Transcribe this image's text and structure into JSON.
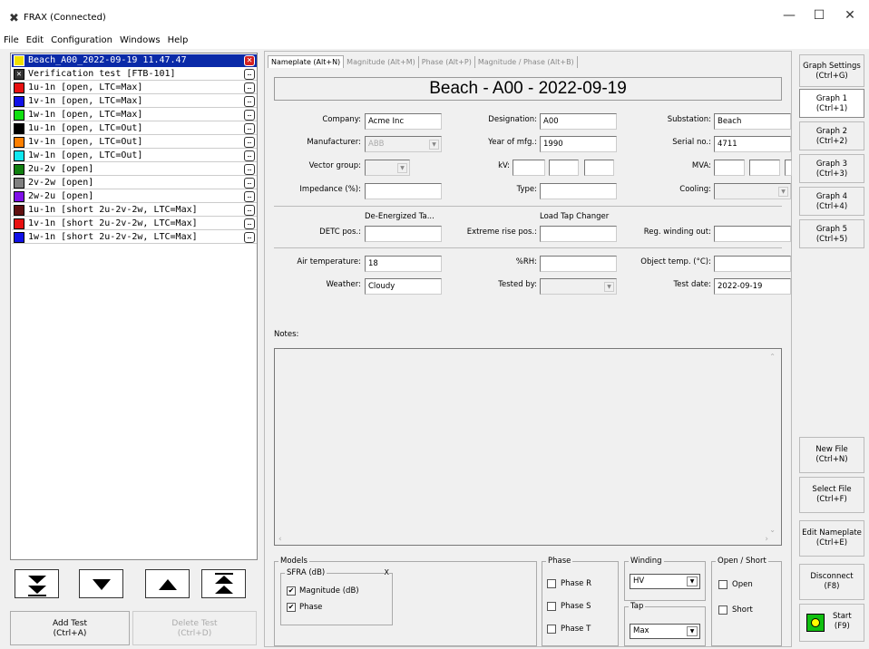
{
  "window": {
    "title": "FRAX (Connected)",
    "minimize": "—",
    "maximize": "☐",
    "close": "✕"
  },
  "menu": [
    "File",
    "Edit",
    "Configuration",
    "Windows",
    "Help"
  ],
  "tests": [
    {
      "label": "Beach_A00_2022-09-19 11.47.47",
      "color": "#0a2aa8",
      "selected": true
    },
    {
      "label": "Verification test [FTB-101]",
      "color": "#ffffff",
      "icon": "x"
    },
    {
      "label": "1u-1n [open, LTC=Max]",
      "color": "#e81010"
    },
    {
      "label": "1v-1n [open, LTC=Max]",
      "color": "#1010e8"
    },
    {
      "label": "1w-1n [open, LTC=Max]",
      "color": "#10e010"
    },
    {
      "label": "1u-1n [open, LTC=Out]",
      "color": "#000000"
    },
    {
      "label": "1v-1n [open, LTC=Out]",
      "color": "#ff8000"
    },
    {
      "label": "1w-1n [open, LTC=Out]",
      "color": "#10e8f0"
    },
    {
      "label": "2u-2v [open]",
      "color": "#108010"
    },
    {
      "label": "2v-2w [open]",
      "color": "#808080"
    },
    {
      "label": "2w-2u [open]",
      "color": "#8010e8"
    },
    {
      "label": "1u-1n [short 2u-2v-2w, LTC=Max]",
      "color": "#601010"
    },
    {
      "label": "1v-1n [short 2u-2v-2w, LTC=Max]",
      "color": "#e81010"
    },
    {
      "label": "1w-1n [short 2u-2v-2w, LTC=Max]",
      "color": "#1010e8"
    }
  ],
  "left_buttons": {
    "add": "Add Test\n(Ctrl+A)",
    "add_line1": "Add Test",
    "add_line2": "(Ctrl+A)",
    "delete_line1": "Delete Test",
    "delete_line2": "(Ctrl+D)"
  },
  "tabs": [
    "Nameplate (Alt+N)",
    "Magnitude (Alt+M)",
    "Phase (Alt+P)",
    "Magnitude / Phase (Alt+B)"
  ],
  "nameplate": {
    "title": "Beach - A00 - 2022-09-19",
    "company_label": "Company:",
    "company": "Acme Inc",
    "designation_label": "Designation:",
    "designation": "A00",
    "substation_label": "Substation:",
    "substation": "Beach",
    "manufacturer_label": "Manufacturer:",
    "manufacturer": "ABB",
    "year_label": "Year of mfg.:",
    "year": "1990",
    "serial_label": "Serial no.:",
    "serial": "4711",
    "vector_label": "Vector group:",
    "kv_label": "kV:",
    "mva_label": "MVA:",
    "impedance_label": "Impedance (%):",
    "type_label": "Type:",
    "cooling_label": "Cooling:",
    "detc_header": "De-Energized Ta...",
    "ltc_header": "Load Tap Changer",
    "detc_label": "DETC pos.:",
    "extreme_label": "Extreme rise pos.:",
    "reg_label": "Reg. winding out:",
    "air_label": "Air temperature:",
    "air": "18",
    "rh_label": "%RH:",
    "obj_label": "Object temp. (°C):",
    "weather_label": "Weather:",
    "weather": "Cloudy",
    "tested_label": "Tested by:",
    "date_label": "Test date:",
    "date": "2022-09-19",
    "notes_label": "Notes:"
  },
  "bottom": {
    "models_title": "Models",
    "sfra_title": "SFRA (dB)",
    "sfra_close": "X",
    "magnitude": "Magnitude (dB)",
    "phase_cb": "Phase",
    "phase_title": "Phase",
    "phase_r": "Phase R",
    "phase_s": "Phase S",
    "phase_t": "Phase T",
    "winding_title": "Winding",
    "winding_value": "HV",
    "tap_title": "Tap",
    "tap_value": "Max",
    "openshort_title": "Open / Short",
    "open": "Open",
    "short": "Short"
  },
  "right": {
    "graph_settings": [
      "Graph Settings",
      "(Ctrl+G)"
    ],
    "graph1": [
      "Graph 1",
      "(Ctrl+1)"
    ],
    "graph2": [
      "Graph 2",
      "(Ctrl+2)"
    ],
    "graph3": [
      "Graph 3",
      "(Ctrl+3)"
    ],
    "graph4": [
      "Graph 4",
      "(Ctrl+4)"
    ],
    "graph5": [
      "Graph 5",
      "(Ctrl+5)"
    ],
    "new_file": [
      "New File",
      "(Ctrl+N)"
    ],
    "select_file": [
      "Select File",
      "(Ctrl+F)"
    ],
    "edit_nameplate": [
      "Edit Nameplate",
      "(Ctrl+E)"
    ],
    "disconnect": [
      "Disconnect",
      "(F8)"
    ],
    "start": [
      "Start",
      "(F9)"
    ]
  }
}
